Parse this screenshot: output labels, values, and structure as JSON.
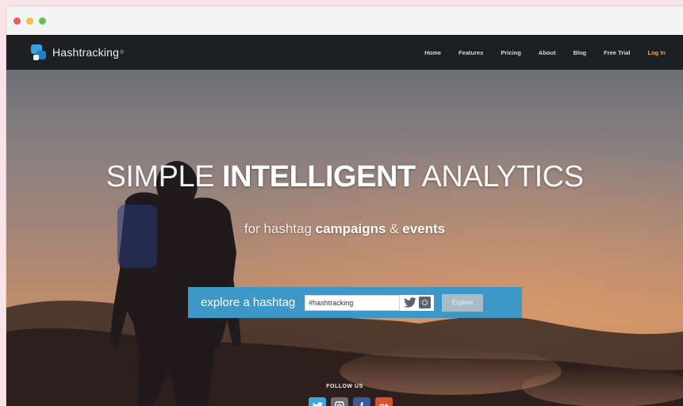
{
  "window": {
    "controls": [
      "close",
      "minimize",
      "maximize"
    ]
  },
  "navbar": {
    "logo_text": "Hashtracking",
    "logo_mark": "®",
    "links": [
      "Home",
      "Features",
      "Pricing",
      "About",
      "Blog",
      "Free Trial",
      "Log In"
    ],
    "login_color": "#f5a623"
  },
  "hero": {
    "headline_thin_1": "SIMPLE ",
    "headline_bold": "INTELLIGENT",
    "headline_thin_2": " ANALYTICS",
    "sub_prefix": "for hashtag ",
    "sub_bold_1": "campaigns",
    "sub_mid": " & ",
    "sub_bold_2": "events"
  },
  "explore": {
    "label": "explore a hashtag",
    "input_value": "#hashtracking",
    "button_label": "Explore",
    "bar_color": "#3d98c7"
  },
  "follow": {
    "label": "FOLLOW US",
    "icons": [
      "twitter-icon",
      "instagram-icon",
      "facebook-icon",
      "google-plus-icon"
    ],
    "fb_glyph": "f",
    "gp_glyph": "g+"
  }
}
